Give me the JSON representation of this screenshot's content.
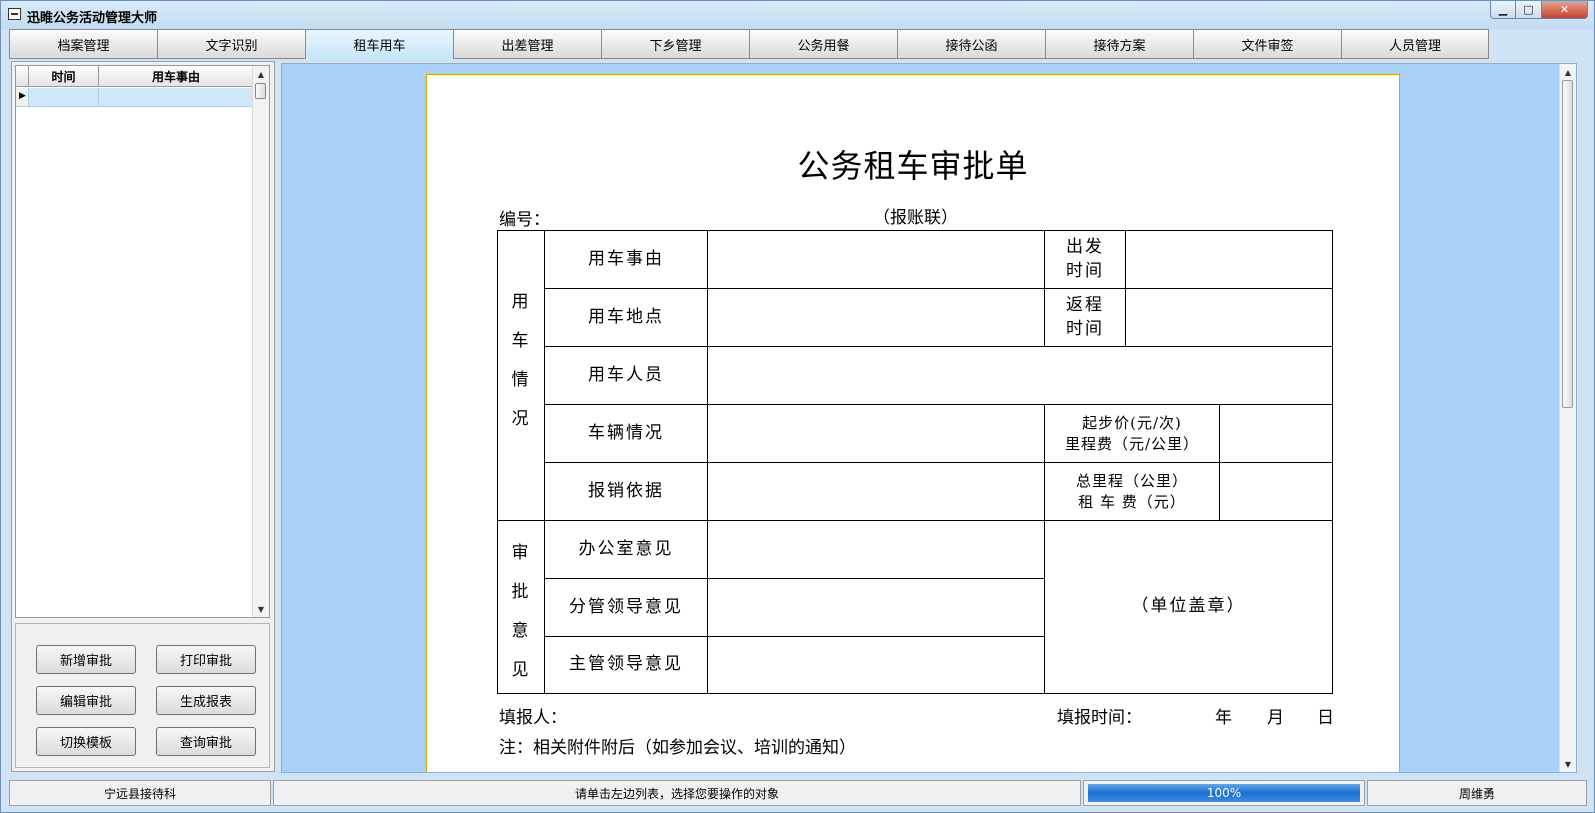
{
  "window": {
    "title": "迅睢公务活动管理大师"
  },
  "tabs": [
    "档案管理",
    "文字识别",
    "租车用车",
    "出差管理",
    "下乡管理",
    "公务用餐",
    "接待公函",
    "接待方案",
    "文件审签",
    "人员管理"
  ],
  "active_tab": "租车用车",
  "list": {
    "headers": [
      "时间",
      "用车事由"
    ]
  },
  "buttons": [
    "新增审批",
    "打印审批",
    "编辑审批",
    "生成报表",
    "切换模板",
    "查询审批"
  ],
  "form": {
    "title": "公务租车审批单",
    "number_label": "编号：",
    "copy_label": "（报账联）",
    "group1": "用车情况",
    "group2": "审批意见",
    "r_reason": "用车事由",
    "r_place": "用车地点",
    "r_people": "用车人员",
    "r_vehicle": "车辆情况",
    "r_basis": "报销依据",
    "r_office": "办公室意见",
    "r_branch": "分管领导意见",
    "r_chief": "主管领导意见",
    "depart_1": "出发",
    "depart_2": "时间",
    "return_1": "返程",
    "return_2": "时间",
    "price_1": "起步价(元/次)",
    "price_2": "里程费（元/公里）",
    "mile_1": "总里程（公里）",
    "mile_2": "租 车 费（元）",
    "seal": "（单位盖章）",
    "filler": "填报人：",
    "fill_time": "填报时间：",
    "year": "年",
    "month": "月",
    "day": "日",
    "note": "注：相关附件附后（如参加会议、培训的通知）"
  },
  "status": {
    "unit": "宁远县接待科",
    "hint": "请单击左边列表，选择您要操作的对象",
    "progress": "100%",
    "user": "周维勇"
  }
}
